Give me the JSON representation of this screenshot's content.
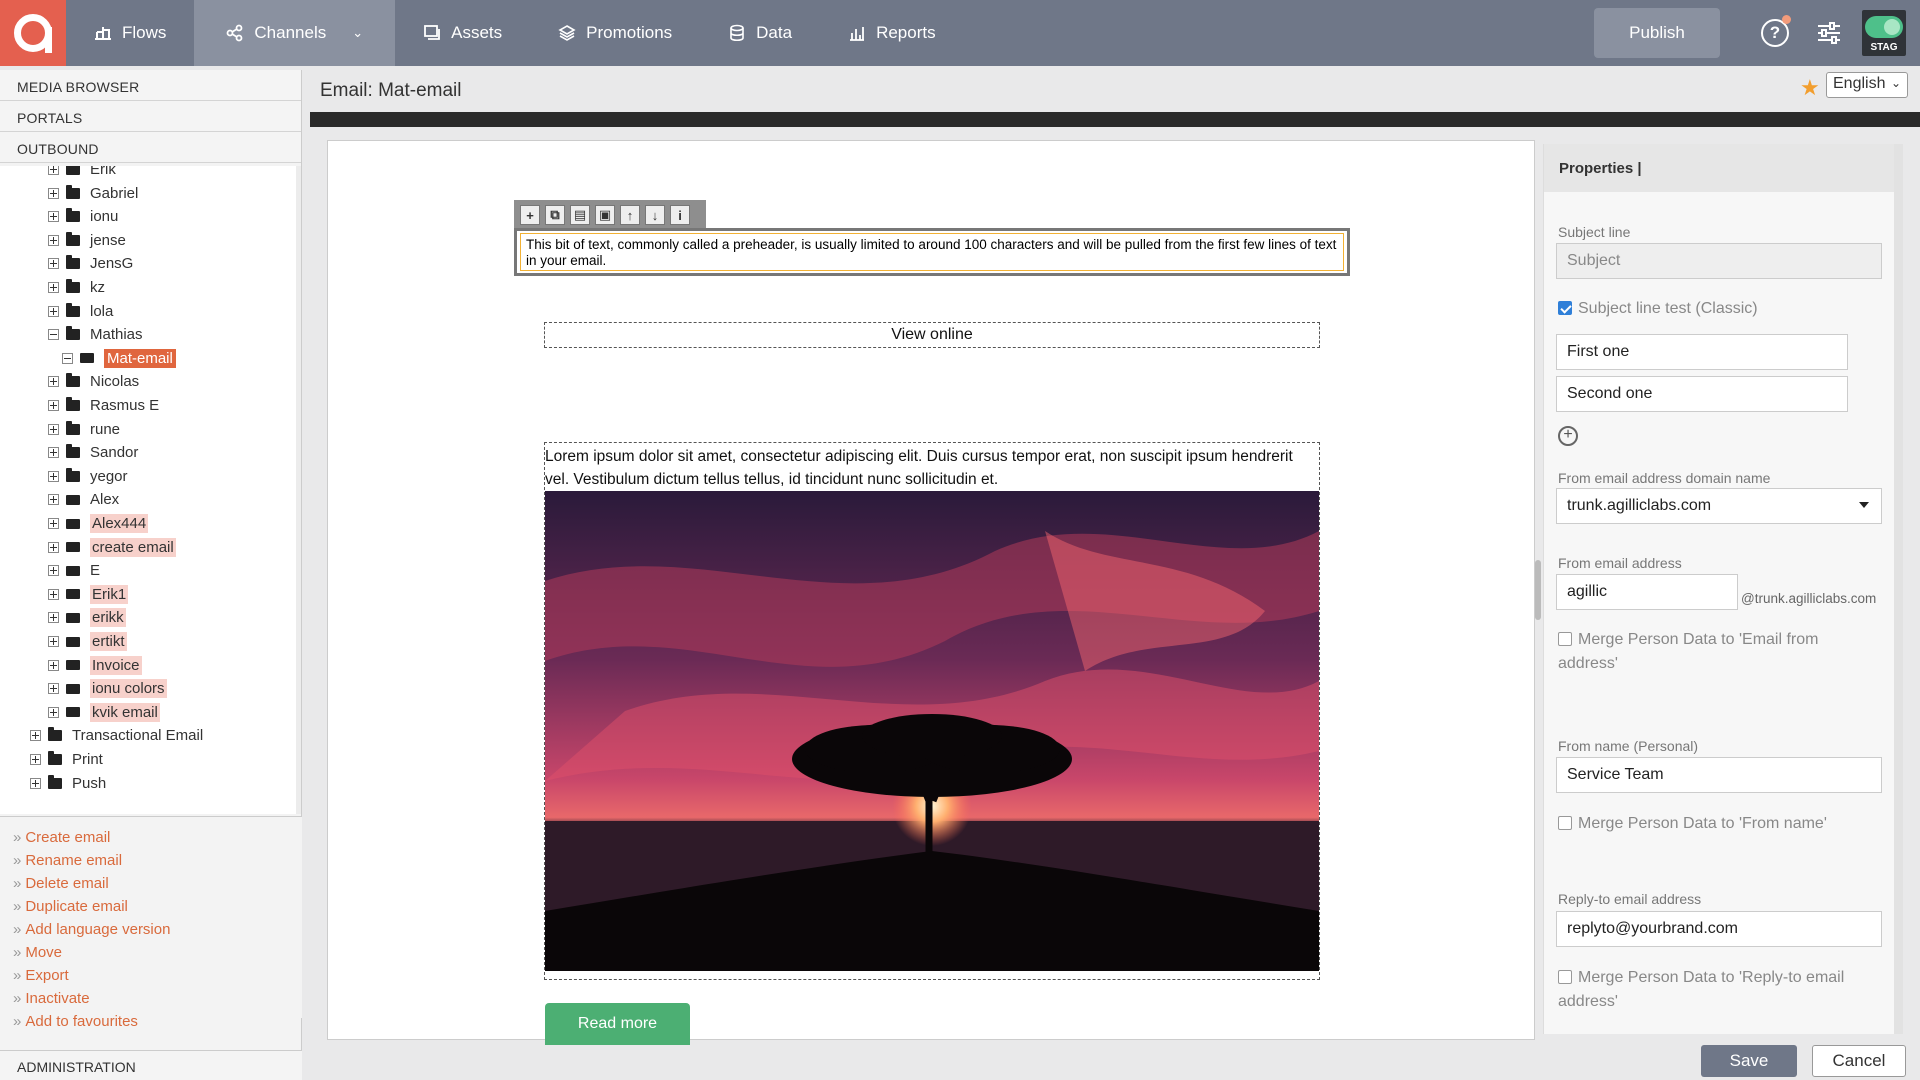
{
  "nav": {
    "items": [
      {
        "label": "Flows",
        "icon": "flows-icon"
      },
      {
        "label": "Channels",
        "icon": "channels-icon",
        "active": true
      },
      {
        "label": "Assets",
        "icon": "assets-icon"
      },
      {
        "label": "Promotions",
        "icon": "promotions-icon"
      },
      {
        "label": "Data",
        "icon": "database-icon"
      },
      {
        "label": "Reports",
        "icon": "reports-icon"
      }
    ],
    "publish_label": "Publish",
    "help_glyph": "?",
    "env_label": "STAG"
  },
  "sidebar": {
    "sections": [
      "MEDIA BROWSER",
      "PORTALS",
      "OUTBOUND"
    ],
    "tree": [
      {
        "label": "Erik",
        "type": "folder",
        "level": 2,
        "expand": "plus"
      },
      {
        "label": "Gabriel",
        "type": "folder",
        "level": 2,
        "expand": "plus"
      },
      {
        "label": "ionu",
        "type": "folder",
        "level": 2,
        "expand": "plus"
      },
      {
        "label": "jense",
        "type": "folder",
        "level": 2,
        "expand": "plus"
      },
      {
        "label": "JensG",
        "type": "folder",
        "level": 2,
        "expand": "plus"
      },
      {
        "label": "kz",
        "type": "folder",
        "level": 2,
        "expand": "plus"
      },
      {
        "label": "lola",
        "type": "folder",
        "level": 2,
        "expand": "plus"
      },
      {
        "label": "Mathias",
        "type": "folder",
        "level": 2,
        "expand": "minus"
      },
      {
        "label": "Mat-email",
        "type": "email",
        "level": 3,
        "expand": "minus",
        "style": "selected"
      },
      {
        "label": "Nicolas",
        "type": "folder",
        "level": 2,
        "expand": "plus"
      },
      {
        "label": "Rasmus E",
        "type": "folder",
        "level": 2,
        "expand": "plus"
      },
      {
        "label": "rune",
        "type": "folder",
        "level": 2,
        "expand": "plus"
      },
      {
        "label": "Sandor",
        "type": "folder",
        "level": 2,
        "expand": "plus"
      },
      {
        "label": "yegor",
        "type": "folder",
        "level": 2,
        "expand": "plus"
      },
      {
        "label": "Alex",
        "type": "email",
        "level": 2,
        "expand": "plus"
      },
      {
        "label": "Alex444",
        "type": "email",
        "level": 2,
        "expand": "plus",
        "style": "highlight"
      },
      {
        "label": "create email",
        "type": "email",
        "level": 2,
        "expand": "plus",
        "style": "highlight"
      },
      {
        "label": "E",
        "type": "email",
        "level": 2,
        "expand": "plus"
      },
      {
        "label": "Erik1",
        "type": "email",
        "level": 2,
        "expand": "plus",
        "style": "highlight"
      },
      {
        "label": "erikk",
        "type": "email",
        "level": 2,
        "expand": "plus",
        "style": "highlight"
      },
      {
        "label": "ertikt",
        "type": "email",
        "level": 2,
        "expand": "plus",
        "style": "highlight"
      },
      {
        "label": "Invoice",
        "type": "email",
        "level": 2,
        "expand": "plus",
        "style": "highlight"
      },
      {
        "label": "ionu colors",
        "type": "email",
        "level": 2,
        "expand": "plus",
        "style": "highlight"
      },
      {
        "label": "kvik email",
        "type": "email",
        "level": 2,
        "expand": "plus",
        "style": "highlight"
      },
      {
        "label": "Transactional Email",
        "type": "folder",
        "level": 1,
        "expand": "plus"
      },
      {
        "label": "Print",
        "type": "folder",
        "level": 1,
        "expand": "plus"
      },
      {
        "label": "Push",
        "type": "folder",
        "level": 1,
        "expand": "plus"
      }
    ],
    "actions": [
      "Create email",
      "Rename email",
      "Delete email",
      "Duplicate email",
      "Add language version",
      "Move",
      "Export",
      "Inactivate",
      "Add to favourites"
    ],
    "action_prefix": "»",
    "admin_label": "ADMINISTRATION"
  },
  "header": {
    "title": "Email: Mat-email",
    "star_glyph": "★",
    "language": "English"
  },
  "canvas": {
    "toolbar_icons": [
      "add-icon",
      "copy-icon",
      "paste-icon",
      "save-icon",
      "move-up-icon",
      "move-down-icon",
      "info-icon"
    ],
    "toolbar_glyphs": [
      "+",
      "⧉",
      "▤",
      "▣",
      "↑",
      "↓",
      "i"
    ],
    "preheader": "This bit of text, commonly called a preheader, is usually limited to around 100 characters and will be pulled from the first few lines of text in your email.",
    "view_online": "View online",
    "lorem": "Lorem ipsum dolor sit amet, consectetur adipiscing elit. Duis cursus tempor erat, non suscipit ipsum hendrerit vel. Vestibulum dictum tellus tellus, id tincidunt nunc sollicitudin et.",
    "read_more": "Read more"
  },
  "properties": {
    "title": "Properties |",
    "subject_line_label": "Subject line",
    "subject_placeholder": "Subject",
    "subject_test_label": "Subject line test (Classic)",
    "subject_test_checked": true,
    "subject_variants": [
      "First one",
      "Second one"
    ],
    "add_glyph": "+",
    "domain_label": "From email address domain name",
    "domain_value": "trunk.agilliclabs.com",
    "from_address_label": "From email address",
    "from_address_value": "agillic",
    "from_address_suffix": "@trunk.agilliclabs.com",
    "merge_from_address": "Merge Person Data to 'Email from address'",
    "from_name_label": "From name (Personal)",
    "from_name_value": "Service Team",
    "merge_from_name": "Merge Person Data to 'From name'",
    "reply_to_label": "Reply-to email address",
    "reply_to_value": "replyto@yourbrand.com",
    "merge_reply_to": "Merge Person Data to 'Reply-to email address'"
  },
  "footer": {
    "save_label": "Save",
    "cancel_label": "Cancel"
  },
  "colors": {
    "nav_bg": "#6f7788",
    "brand": "#e4604f",
    "link": "#d96a3c",
    "selected": "#e0663e",
    "highlight": "#f7d1cb",
    "read_more": "#4caf73"
  }
}
